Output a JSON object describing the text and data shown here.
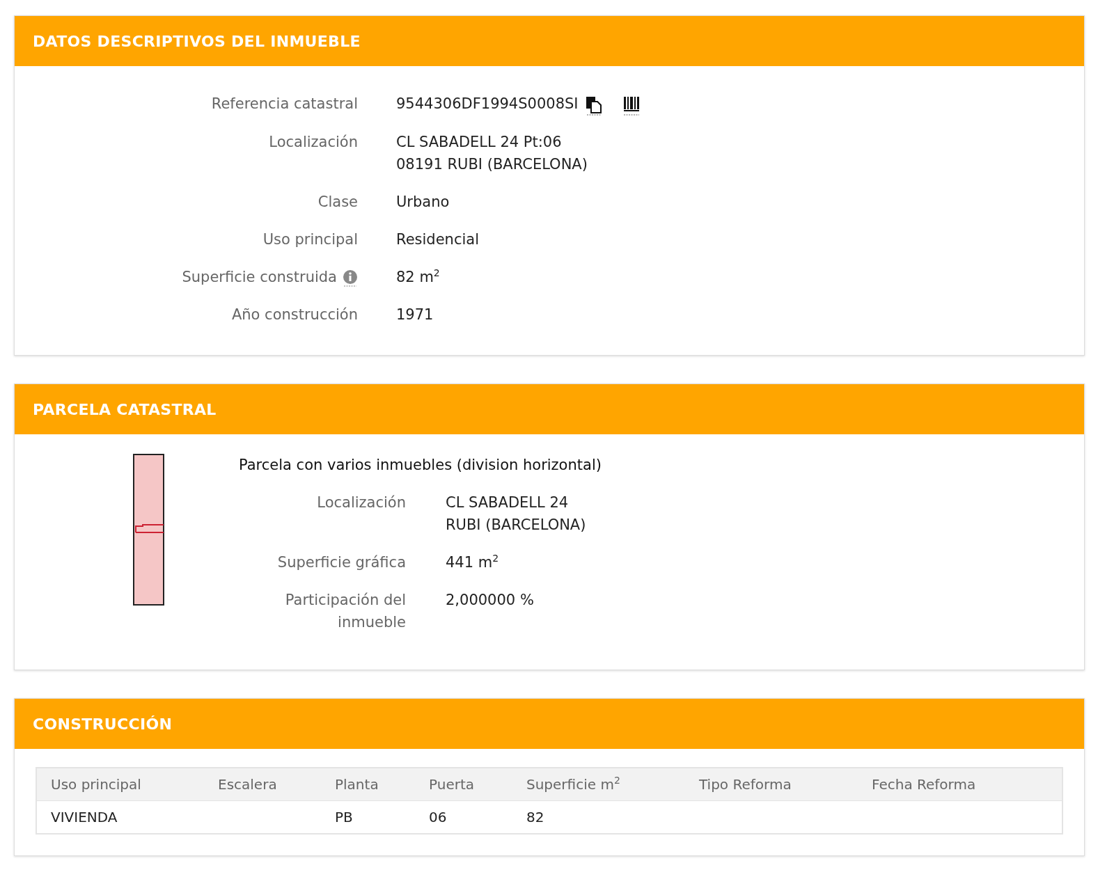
{
  "sections": [
    {
      "kind": "fields",
      "title": "DATOS DESCRIPTIVOS DEL INMUEBLE",
      "fields": [
        {
          "kind": "reference",
          "label": "Referencia catastral",
          "lines": [
            "9544306DF1994S0008SI"
          ],
          "info": false
        },
        {
          "kind": "text",
          "label": "Localización",
          "lines": [
            "CL SABADELL 24 Pt:06",
            "08191 RUBI (BARCELONA)"
          ],
          "info": false
        },
        {
          "kind": "text",
          "label": "Clase",
          "lines": [
            "Urbano"
          ],
          "info": false
        },
        {
          "kind": "text",
          "label": "Uso principal",
          "lines": [
            "Residencial"
          ],
          "info": false
        },
        {
          "kind": "text",
          "label": "Superficie construida",
          "lines": [
            "82 m$^{2}$"
          ],
          "info": true
        },
        {
          "kind": "text",
          "label": "Año construcción",
          "lines": [
            "1971"
          ],
          "info": false
        }
      ]
    },
    {
      "kind": "parcel",
      "title": "PARCELA CATASTRAL",
      "heading": "Parcela con varios inmuebles (division horizontal)",
      "fields": [
        {
          "kind": "text",
          "label": "Localización",
          "lines": [
            "CL SABADELL 24",
            "RUBI (BARCELONA)"
          ],
          "info": false
        },
        {
          "kind": "text",
          "label": "Superficie gráfica",
          "lines": [
            "441 m$^{2}$"
          ],
          "info": false
        },
        {
          "kind": "text",
          "label": "Participación del inmueble",
          "lines": [
            "2,000000 %"
          ],
          "info": false
        }
      ]
    },
    {
      "kind": "table",
      "title": "CONSTRUCCIÓN",
      "columns": [
        "Uso principal",
        "Escalera",
        "Planta",
        "Puerta",
        "Superficie m$^{2}$",
        "Tipo Reforma",
        "Fecha Reforma"
      ],
      "rows": [
        [
          "VIVIENDA",
          "",
          "PB",
          "06",
          "82",
          "",
          ""
        ]
      ]
    }
  ]
}
